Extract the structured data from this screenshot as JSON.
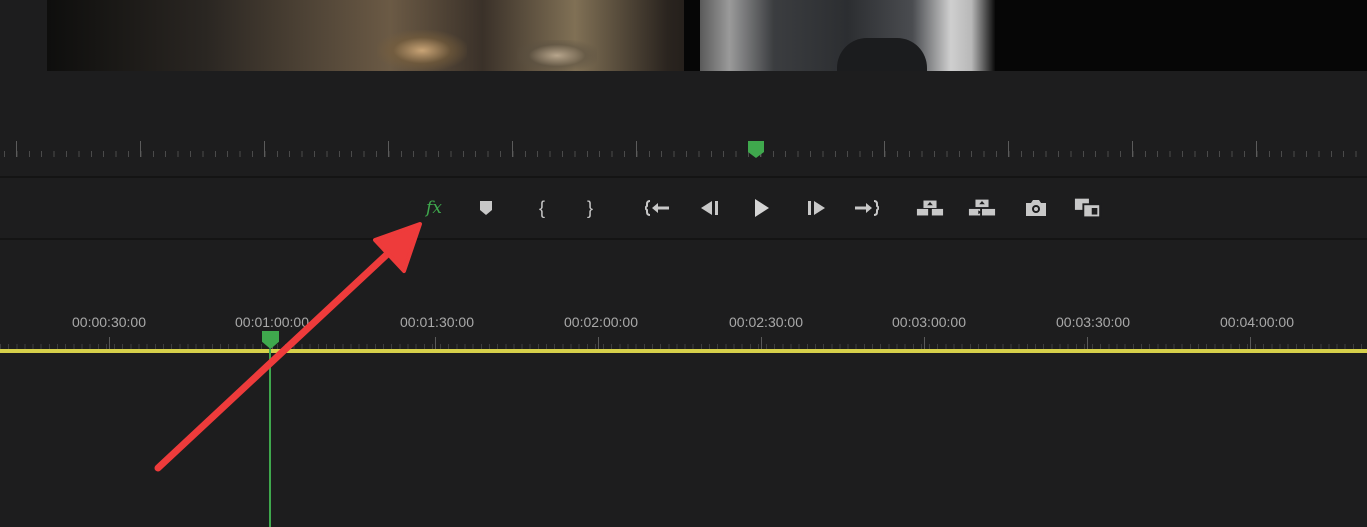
{
  "monitor": {
    "controls": {
      "fx": {
        "label": "fx",
        "icon": "fx-icon",
        "color": "#3fa84d"
      },
      "add_marker": {
        "icon": "marker-icon"
      },
      "mark_in": {
        "icon": "mark-in-icon",
        "glyph": "{"
      },
      "mark_out": {
        "icon": "mark-out-icon",
        "glyph": "}"
      },
      "go_to_in": {
        "icon": "go-to-in-icon"
      },
      "step_back": {
        "icon": "step-back-icon"
      },
      "play": {
        "icon": "play-icon"
      },
      "step_forward": {
        "icon": "step-forward-icon"
      },
      "go_to_out": {
        "icon": "go-to-out-icon"
      },
      "lift": {
        "icon": "lift-icon"
      },
      "extract": {
        "icon": "extract-icon"
      },
      "export_frame": {
        "icon": "camera-icon"
      },
      "comparison_view": {
        "icon": "comparison-view-icon"
      }
    }
  },
  "timeline": {
    "timecodes": [
      "00:00:30:00",
      "00:01:00:00",
      "00:01:30:00",
      "00:02:00:00",
      "00:02:30:00",
      "00:03:00:00",
      "00:03:30:00",
      "00:04:00:00"
    ]
  },
  "colors": {
    "accent": "#3fa84d",
    "work_area": "#d6d04a",
    "annotation_arrow": "#ee3b3b",
    "background": "#1d1d1e"
  }
}
